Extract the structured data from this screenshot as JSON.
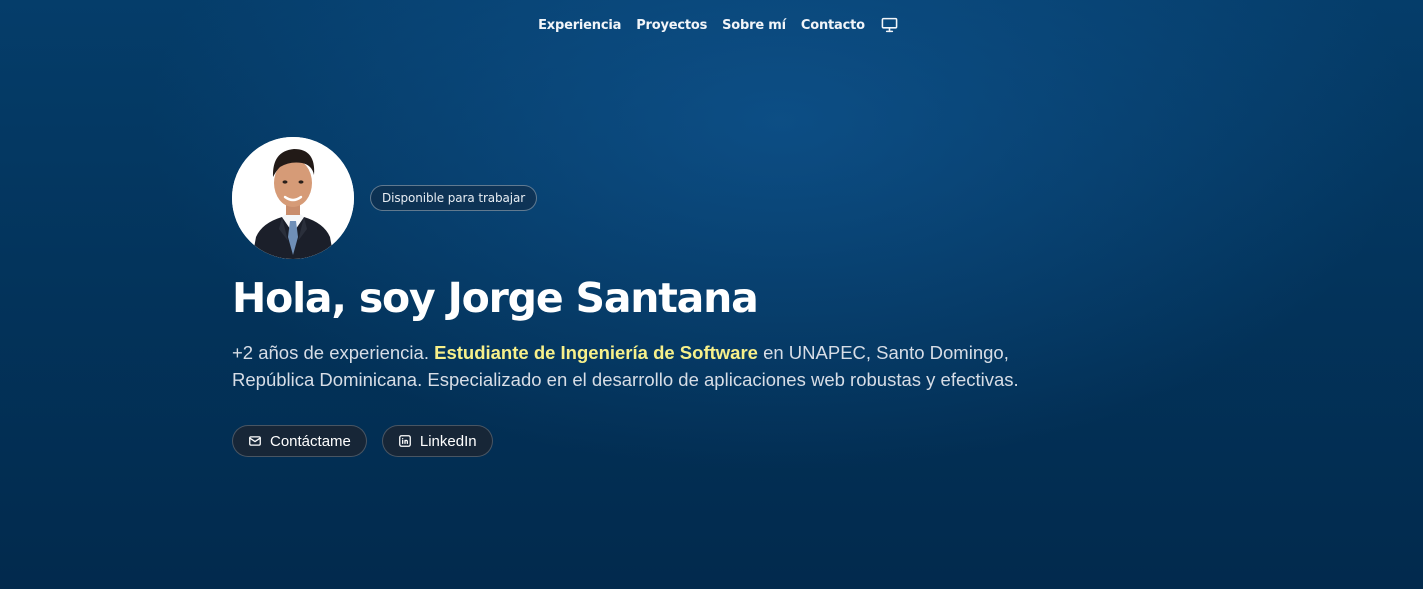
{
  "nav": {
    "items": [
      {
        "label": "Experiencia"
      },
      {
        "label": "Proyectos"
      },
      {
        "label": "Sobre mí"
      },
      {
        "label": "Contacto"
      }
    ],
    "theme_icon": "monitor-icon"
  },
  "hero": {
    "badge": "Disponible para trabajar",
    "title": "Hola, soy Jorge Santana",
    "description": {
      "part1": "+2 años de experiencia. ",
      "highlight": "Estudiante de Ingeniería de Software",
      "part2": " en UNAPEC, Santo Domingo, República Dominicana. Especializado en el desarrollo de aplicaciones web robustas y efectivas."
    },
    "buttons": [
      {
        "label": "Contáctame",
        "icon": "mail-icon"
      },
      {
        "label": "LinkedIn",
        "icon": "linkedin-icon"
      }
    ]
  },
  "colors": {
    "background": "#03345c",
    "highlight": "#f7f08a",
    "text": "#ffffff"
  }
}
